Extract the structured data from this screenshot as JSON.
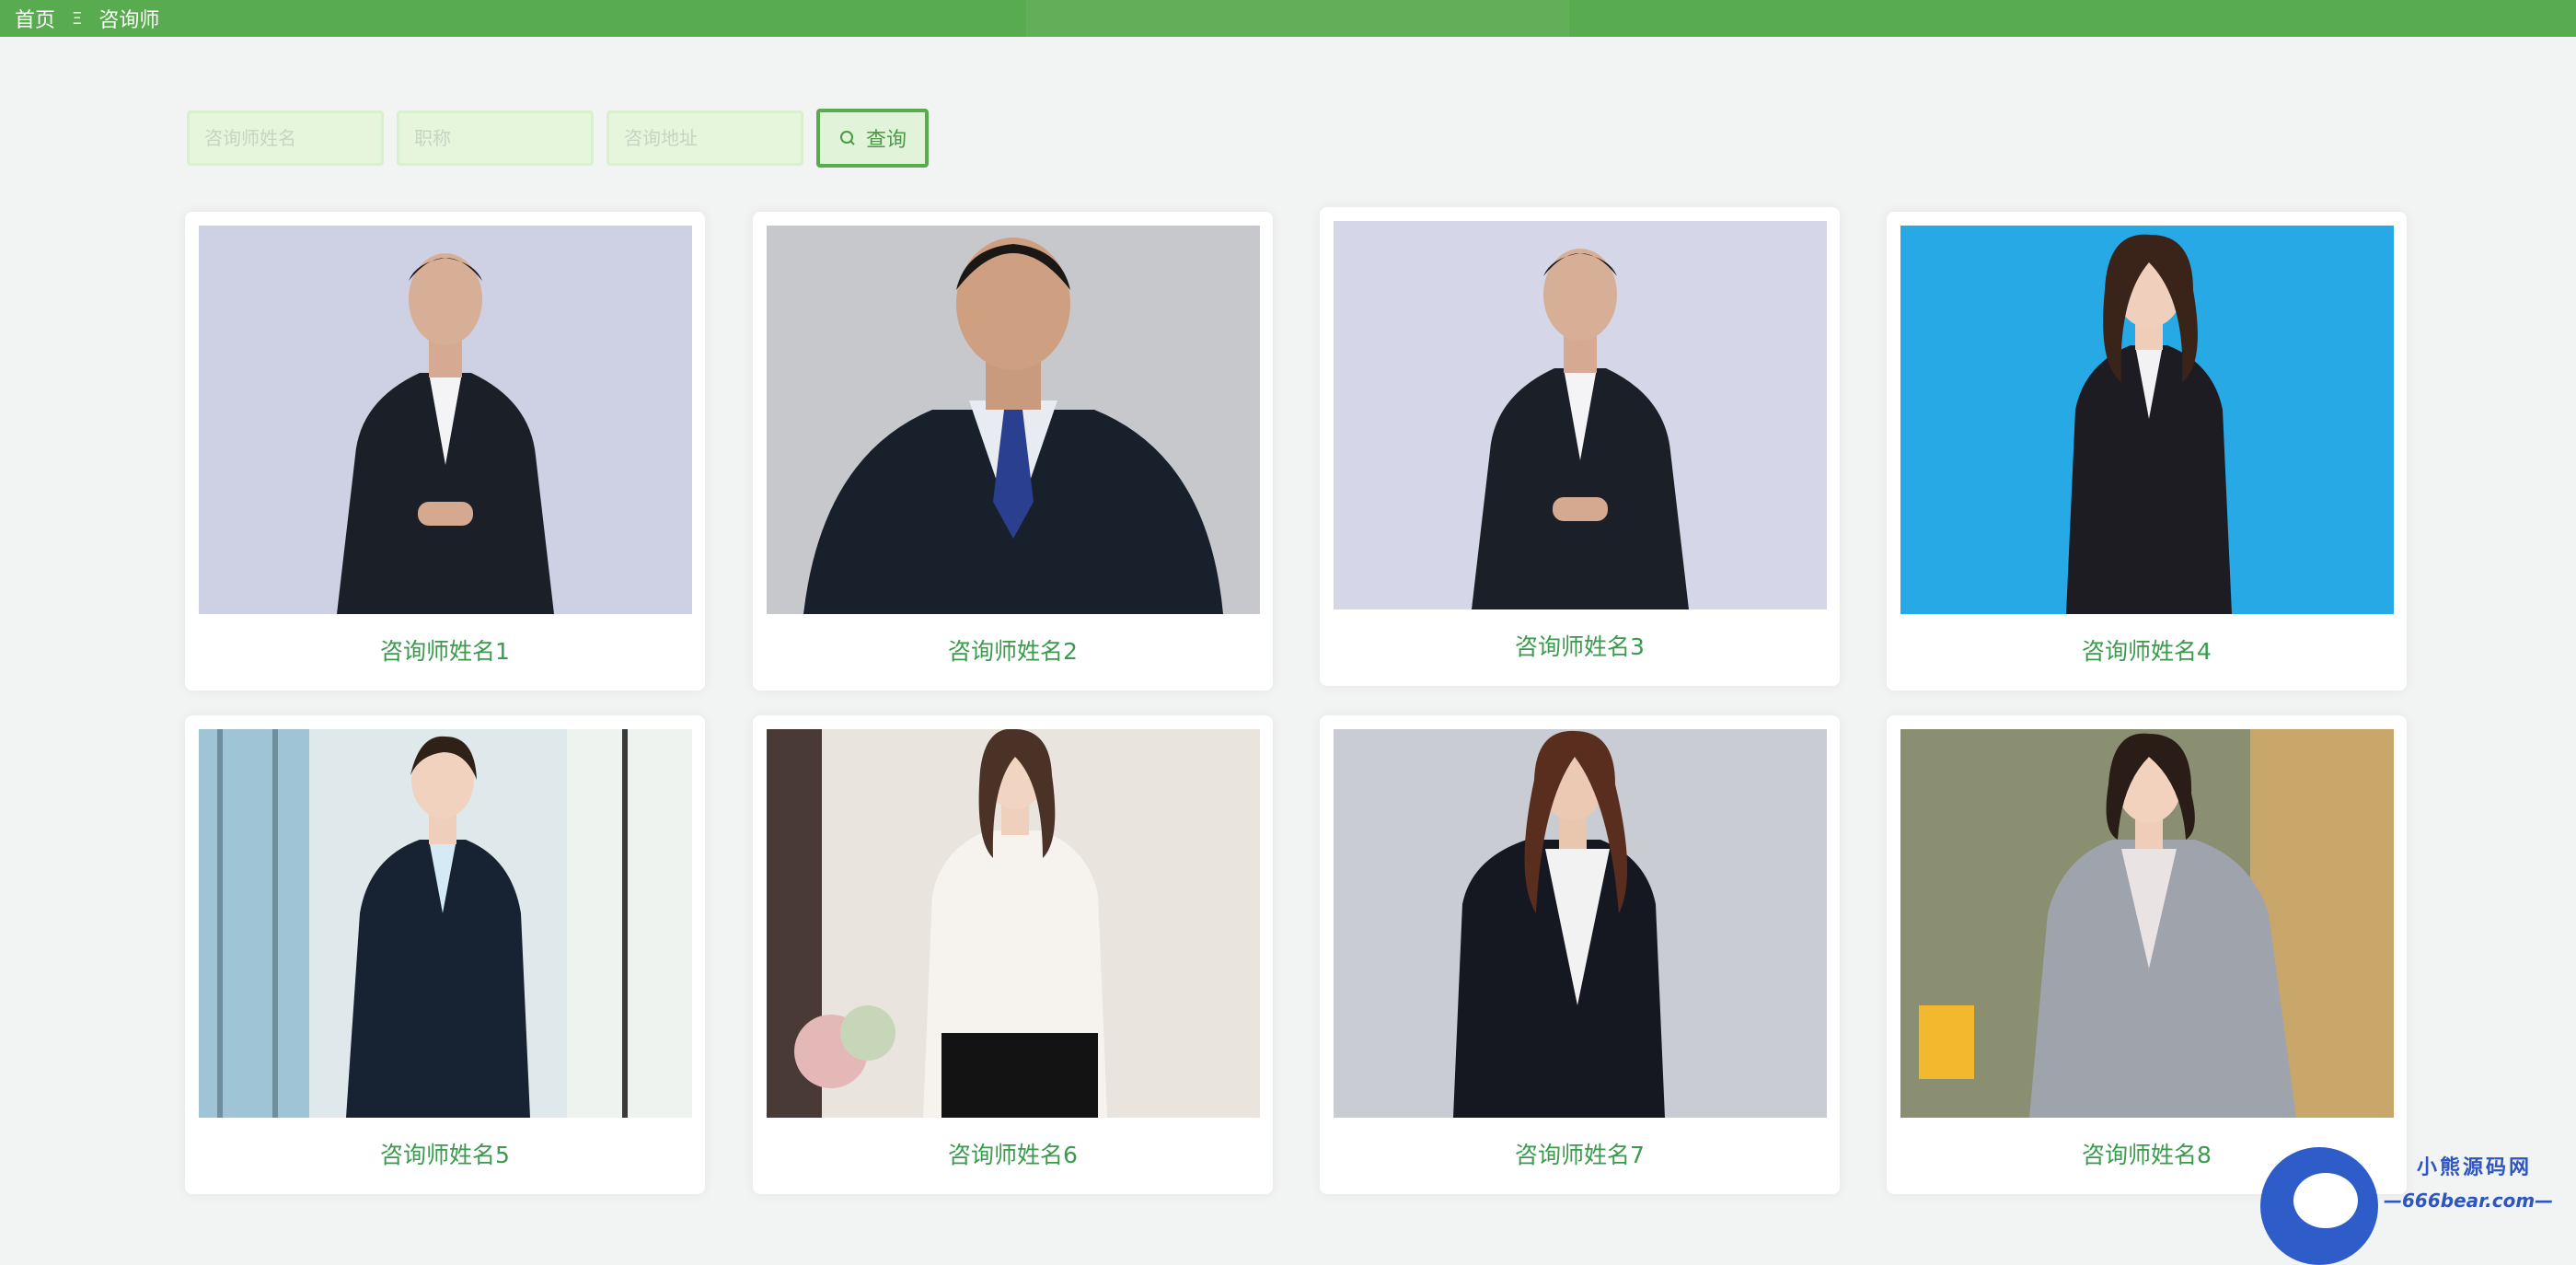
{
  "breadcrumb": {
    "home": "首页",
    "separator": "Ξ",
    "current": "咨询师"
  },
  "search": {
    "name_placeholder": "咨询师姓名",
    "title_placeholder": "职称",
    "address_placeholder": "咨询地址",
    "button_label": "查询"
  },
  "consultants": [
    {
      "name": "咨询师姓名1",
      "photo": "man-dark-suit-grey-bg"
    },
    {
      "name": "咨询师姓名2",
      "photo": "man-suit-blue-tie"
    },
    {
      "name": "咨询师姓名3",
      "photo": "man-dark-suit-grey-bg"
    },
    {
      "name": "咨询师姓名4",
      "photo": "woman-black-suit-blue-bg"
    },
    {
      "name": "咨询师姓名5",
      "photo": "woman-navy-suit-office"
    },
    {
      "name": "咨询师姓名6",
      "photo": "woman-white-blouse"
    },
    {
      "name": "咨询师姓名7",
      "photo": "woman-black-jacket"
    },
    {
      "name": "咨询师姓名8",
      "photo": "woman-plaid-blazer"
    }
  ],
  "watermark": {
    "title": "小熊源码网",
    "url": "—666bear.com—"
  },
  "colors": {
    "accent": "#59ab4f",
    "name_text": "#3c9a4f",
    "watermark": "#2d56c1"
  }
}
